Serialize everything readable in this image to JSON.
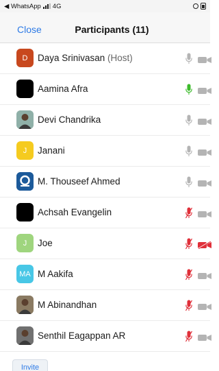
{
  "status_bar": {
    "back_app": "◀ WhatsApp",
    "network": "4G"
  },
  "nav": {
    "close_label": "Close",
    "title": "Participants (11)"
  },
  "participants": [
    {
      "name": "Daya Srinivasan",
      "suffix": " (Host)",
      "initial": "D",
      "avatar_color": "#c8481e",
      "avatar_type": "initial",
      "mic": "on",
      "video": "off"
    },
    {
      "name": "Aamina Afra",
      "suffix": "",
      "initial": "",
      "avatar_color": "#000000",
      "avatar_type": "solid",
      "mic": "active",
      "video": "off"
    },
    {
      "name": "Devi Chandrika",
      "suffix": "",
      "initial": "",
      "avatar_color": "#8fb0a8",
      "avatar_type": "photo",
      "mic": "on",
      "video": "off"
    },
    {
      "name": "Janani",
      "suffix": "",
      "initial": "J",
      "avatar_color": "#f5cb1f",
      "avatar_type": "initial",
      "mic": "on",
      "video": "off"
    },
    {
      "name": "M. Thouseef Ahmed",
      "suffix": "",
      "initial": "",
      "avatar_color": "#1c5a9a",
      "avatar_type": "logo",
      "mic": "on",
      "video": "off"
    },
    {
      "name": "Achsah Evangelin",
      "suffix": "",
      "initial": "",
      "avatar_color": "#000000",
      "avatar_type": "solid",
      "mic": "muted",
      "video": "off"
    },
    {
      "name": "Joe",
      "suffix": "",
      "initial": "J",
      "avatar_color": "#9fd57e",
      "avatar_type": "initial",
      "mic": "muted",
      "video": "muted"
    },
    {
      "name": "M Aakifa",
      "suffix": "",
      "initial": "MA",
      "avatar_color": "#48c7e6",
      "avatar_type": "initial",
      "mic": "muted",
      "video": "off"
    },
    {
      "name": "M Abinandhan",
      "suffix": "",
      "initial": "",
      "avatar_color": "#8a7a62",
      "avatar_type": "photo",
      "mic": "muted",
      "video": "off"
    },
    {
      "name": "Senthil Eagappan AR",
      "suffix": "",
      "initial": "",
      "avatar_color": "#707070",
      "avatar_type": "photo",
      "mic": "muted",
      "video": "off"
    }
  ],
  "invite_label": "Invite",
  "colors": {
    "accent": "#2e7be6",
    "mic_active": "#3dbb2c",
    "muted": "#e0303a",
    "icon_gray": "#b4b4b4"
  }
}
